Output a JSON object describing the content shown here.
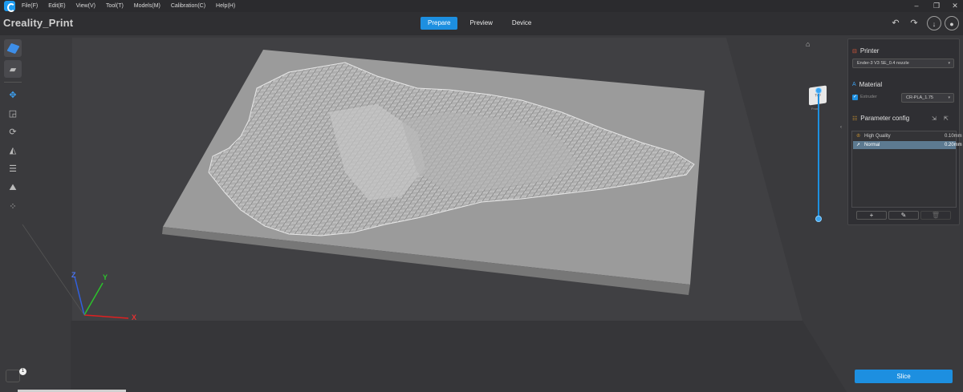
{
  "menu": [
    "File(F)",
    "Edit(E)",
    "View(V)",
    "Tool(T)",
    "Models(M)",
    "Calibration(C)",
    "Help(H)"
  ],
  "title": "Creality_Print",
  "tabs": [
    {
      "label": "Prepare",
      "active": true
    },
    {
      "label": "Preview",
      "active": false
    },
    {
      "label": "Device",
      "active": false
    }
  ],
  "panel": {
    "printer_heading": "Printer",
    "printer_value": "Ender-3 V3 SE_0.4 nozzle",
    "material_heading": "Material",
    "extruder_label": "Extruder",
    "material_value": "CR-PLA_1.75",
    "param_heading": "Parameter config",
    "profiles": [
      {
        "name": "High Quality",
        "value": "0.10mm",
        "selected": false
      },
      {
        "name": "Normal",
        "value": "0.20mm",
        "selected": true
      }
    ]
  },
  "viewcube": {
    "top": "Top",
    "front": "Front"
  },
  "axes": {
    "x": "X",
    "y": "Y",
    "z": "Z"
  },
  "slice_label": "Slice",
  "notification_count": "1",
  "colors": {
    "accent": "#1d8fe0",
    "background": "#3a3a3d",
    "panel": "#2f2f33"
  }
}
